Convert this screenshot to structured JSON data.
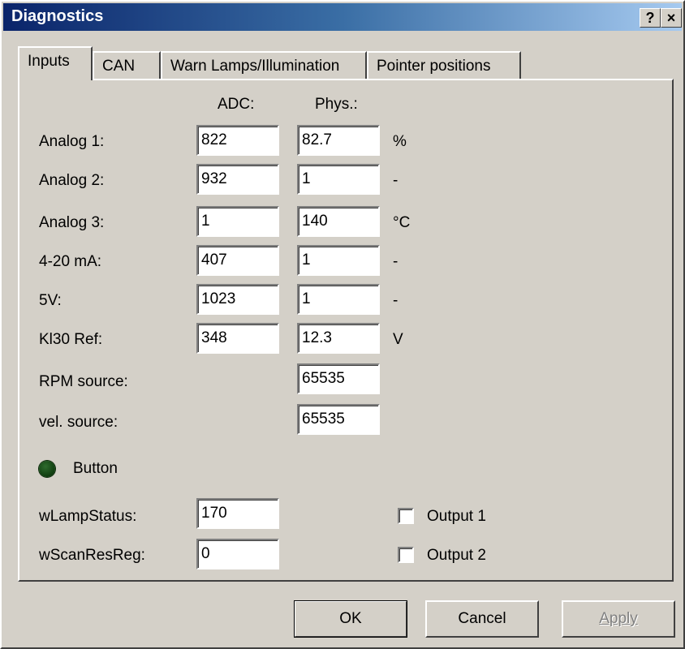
{
  "window": {
    "title": "Diagnostics",
    "help_glyph": "?",
    "close_glyph": "×"
  },
  "tabs": [
    {
      "label": "Inputs",
      "active": true
    },
    {
      "label": "CAN",
      "active": false
    },
    {
      "label": "Warn Lamps/Illumination",
      "active": false
    },
    {
      "label": "Pointer positions",
      "active": false
    }
  ],
  "headers": {
    "adc": "ADC:",
    "phys": "Phys.:"
  },
  "rows": [
    {
      "label": "Analog 1:",
      "adc": "822",
      "phys": "82.7",
      "unit": "%"
    },
    {
      "label": "Analog 2:",
      "adc": "932",
      "phys": "1",
      "unit": "-"
    },
    {
      "label": "Analog 3:",
      "adc": "1",
      "phys": "140",
      "unit": "°C"
    },
    {
      "label": "4-20 mA:",
      "adc": "407",
      "phys": "1",
      "unit": "-"
    },
    {
      "label": "5V:",
      "adc": "1023",
      "phys": "1",
      "unit": "-"
    },
    {
      "label": "Kl30 Ref:",
      "adc": "348",
      "phys": "12.3",
      "unit": "V"
    },
    {
      "label": "RPM source:",
      "adc": null,
      "phys": "65535",
      "unit": ""
    },
    {
      "label": "vel. source:",
      "adc": null,
      "phys": "65535",
      "unit": ""
    }
  ],
  "button_indicator": {
    "label": "Button",
    "color": "#0f3d0f",
    "icon": "led-indicator-icon"
  },
  "status_fields": [
    {
      "label": "wLampStatus:",
      "value": "170"
    },
    {
      "label": "wScanResReg:",
      "value": "0"
    }
  ],
  "outputs": [
    {
      "label": "Output 1",
      "checked": false
    },
    {
      "label": "Output 2",
      "checked": false
    }
  ],
  "buttons": {
    "ok": "OK",
    "cancel": "Cancel",
    "apply": "Apply"
  },
  "colors": {
    "titlebar_start": "#0a246a",
    "titlebar_end": "#a6caf0",
    "face": "#d4d0c8"
  }
}
